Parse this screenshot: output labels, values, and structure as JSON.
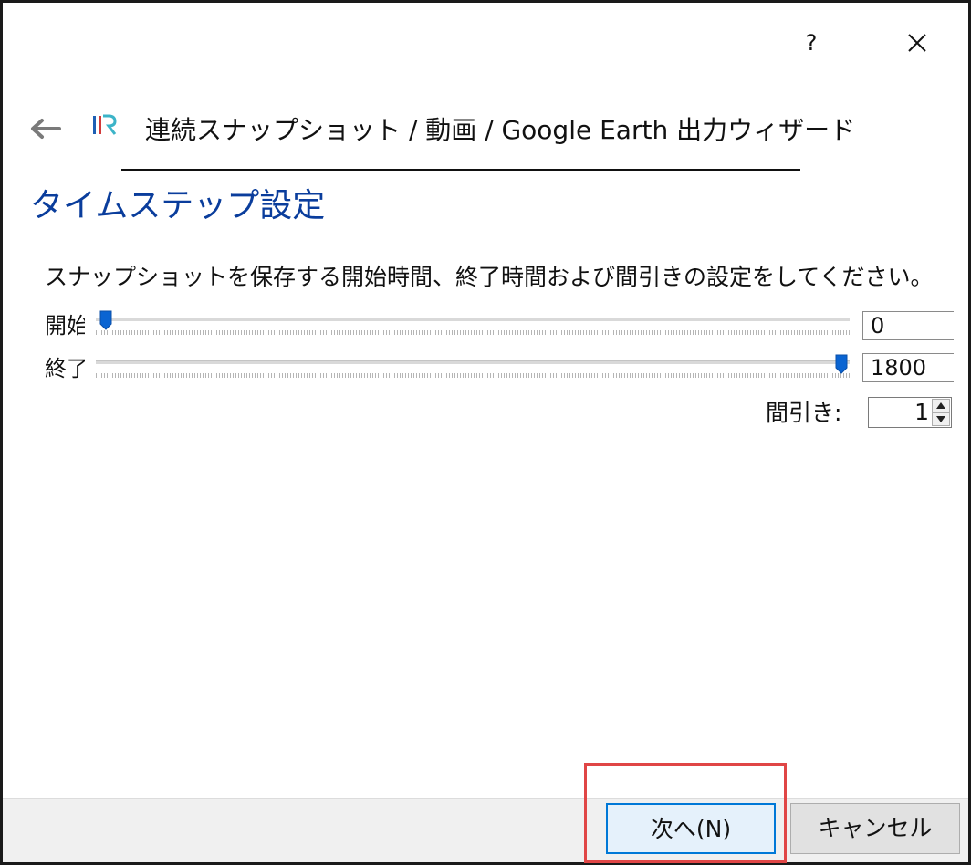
{
  "titlebar": {
    "help_label": "?"
  },
  "header": {
    "title": "連続スナップショット / 動画 / Google Earth 出力ウィザード"
  },
  "page": {
    "heading": "タイムステップ設定",
    "description": "スナップショットを保存する開始時間、終了時間および間引きの設定をしてください。"
  },
  "start": {
    "label": "開始",
    "value": "0",
    "slider_fraction": 0.0
  },
  "end": {
    "label": "終了",
    "value": "1800",
    "slider_fraction": 1.0
  },
  "skip": {
    "label": "間引き:",
    "value": "1"
  },
  "buttons": {
    "next": "次へ(N)",
    "cancel": "キャンセル"
  },
  "colors": {
    "heading": "#0a3d9c",
    "accent": "#0078d7",
    "highlight": "#e04646"
  }
}
